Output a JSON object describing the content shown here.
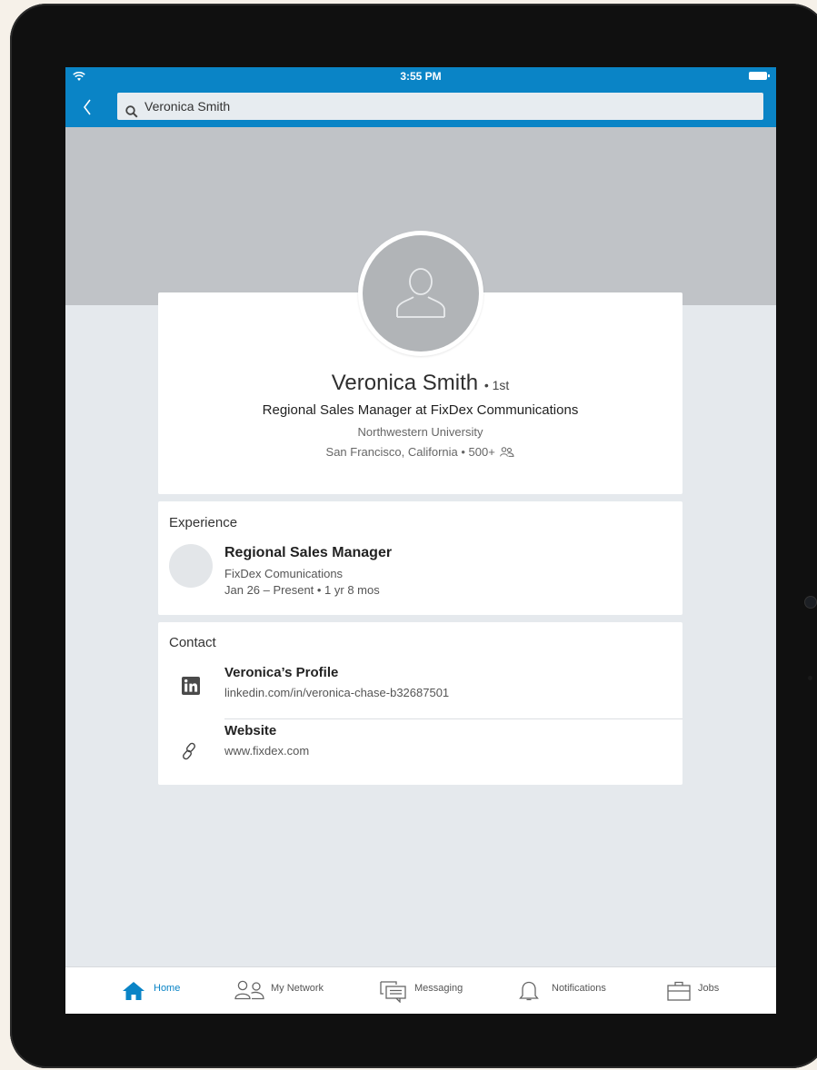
{
  "status": {
    "time": "3:55 PM"
  },
  "search": {
    "query": "Veronica Smith"
  },
  "profile": {
    "name": "Veronica Smith",
    "degree": "• 1st",
    "headline": "Regional Sales Manager at FixDex Communications",
    "school": "Northwestern University",
    "location": "San Francisco, California • 500+"
  },
  "experience": {
    "title": "Experience",
    "role": "Regional Sales Manager",
    "company": "FixDex Comunications",
    "dates": "Jan 26 – Present • 1 yr 8 mos"
  },
  "contact": {
    "title": "Contact",
    "items": [
      {
        "label": "Veronica’s Profile",
        "value": "linkedin.com/in/veronica-chase-b32687501",
        "icon": "linkedin-icon"
      },
      {
        "label": "Website",
        "value": "www.fixdex.com",
        "icon": "link-icon"
      }
    ]
  },
  "tabs": [
    {
      "label": "Home",
      "icon": "home-icon",
      "active": true
    },
    {
      "label": "My Network",
      "icon": "network-icon",
      "active": false
    },
    {
      "label": "Messaging",
      "icon": "messaging-icon",
      "active": false
    },
    {
      "label": "Notifications",
      "icon": "bell-icon",
      "active": false
    },
    {
      "label": "Jobs",
      "icon": "briefcase-icon",
      "active": false
    }
  ],
  "colors": {
    "brand": "#0a84c6",
    "cover": "#c0c3c7",
    "background": "#e5e9ed"
  }
}
